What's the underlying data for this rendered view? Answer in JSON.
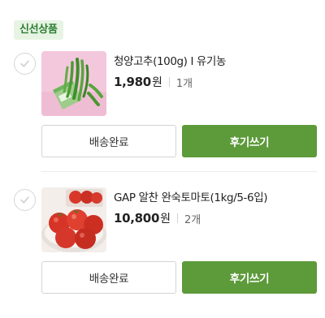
{
  "section": {
    "badge": "신선상품"
  },
  "items": [
    {
      "name": "청양고추(100g) I 유기농",
      "price": "1,980",
      "currency": "원",
      "quantity": "1개",
      "buttons": {
        "status": "배송완료",
        "review": "후기쓰기"
      },
      "thumbnail": "green chili peppers on pink background"
    },
    {
      "name": "GAP 알찬 완숙토마토(1kg/5-6입)",
      "price": "10,800",
      "currency": "원",
      "quantity": "2개",
      "buttons": {
        "status": "배송완료",
        "review": "후기쓰기"
      },
      "thumbnail": "ripe tomatoes on plate"
    }
  ],
  "colors": {
    "accent": "#5c9a3a",
    "badge_bg": "#e7f4e4",
    "badge_text": "#2e7d32"
  }
}
